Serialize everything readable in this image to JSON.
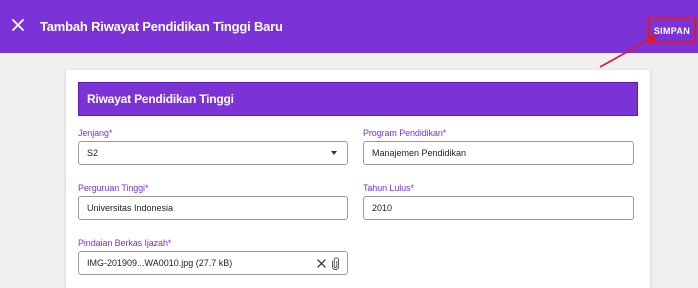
{
  "app_bar": {
    "title": "Tambah Riwayat Pendidikan Tinggi Baru",
    "save_label": "SIMPAN",
    "close_icon": "close-icon",
    "background": "#7b33d8",
    "highlight_color": "#e0192a"
  },
  "card": {
    "title": "Riwayat Pendidikan Tinggi",
    "fields": {
      "jenjang": {
        "label": "Jenjang*",
        "value": "S2"
      },
      "program": {
        "label": "Program Pendidikan*",
        "value": "Manajemen Pendidikan"
      },
      "perguruan": {
        "label": "Perguruan Tinggi*",
        "value": "Universitas Indonesia"
      },
      "tahun": {
        "label": "Tahun Lulus*",
        "value": "2010"
      },
      "berkas": {
        "label": "Pindaian Berkas Ijazah*",
        "value": "IMG-201909...WA0010.jpg (27.7 kB)"
      }
    }
  }
}
